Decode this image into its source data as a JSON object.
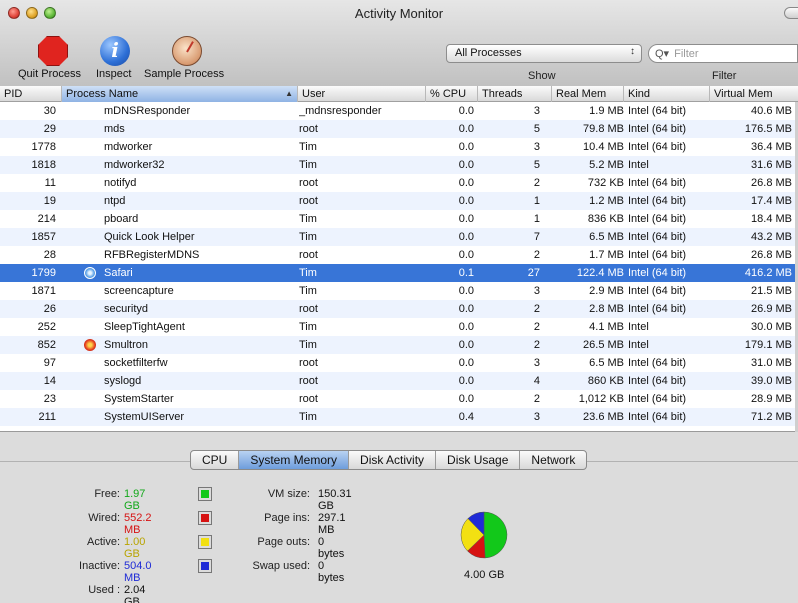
{
  "window": {
    "title": "Activity Monitor"
  },
  "toolbar": {
    "quit_label": "Quit Process",
    "inspect_label": "Inspect",
    "sample_label": "Sample Process",
    "show_selected": "All Processes",
    "show_label": "Show",
    "filter_placeholder": "Filter",
    "filter_label": "Filter"
  },
  "table": {
    "columns": [
      "PID",
      "Process Name",
      "User",
      "% CPU",
      "Threads",
      "Real Mem",
      "Kind",
      "Virtual Mem"
    ],
    "sorted_column": "Process Name",
    "rows": [
      {
        "pid": "30",
        "name": "mDNSResponder",
        "user": "_mdnsresponder",
        "cpu": "0.0",
        "threads": "3",
        "real": "1.9 MB",
        "kind": "Intel (64 bit)",
        "virtual": "40.6 MB"
      },
      {
        "pid": "29",
        "name": "mds",
        "user": "root",
        "cpu": "0.0",
        "threads": "5",
        "real": "79.8 MB",
        "kind": "Intel (64 bit)",
        "virtual": "176.5 MB"
      },
      {
        "pid": "1778",
        "name": "mdworker",
        "user": "Tim",
        "cpu": "0.0",
        "threads": "3",
        "real": "10.4 MB",
        "kind": "Intel (64 bit)",
        "virtual": "36.4 MB"
      },
      {
        "pid": "1818",
        "name": "mdworker32",
        "user": "Tim",
        "cpu": "0.0",
        "threads": "5",
        "real": "5.2 MB",
        "kind": "Intel",
        "virtual": "31.6 MB"
      },
      {
        "pid": "11",
        "name": "notifyd",
        "user": "root",
        "cpu": "0.0",
        "threads": "2",
        "real": "732 KB",
        "kind": "Intel (64 bit)",
        "virtual": "26.8 MB"
      },
      {
        "pid": "19",
        "name": "ntpd",
        "user": "root",
        "cpu": "0.0",
        "threads": "1",
        "real": "1.2 MB",
        "kind": "Intel (64 bit)",
        "virtual": "17.4 MB"
      },
      {
        "pid": "214",
        "name": "pboard",
        "user": "Tim",
        "cpu": "0.0",
        "threads": "1",
        "real": "836 KB",
        "kind": "Intel (64 bit)",
        "virtual": "18.4 MB"
      },
      {
        "pid": "1857",
        "name": "Quick Look Helper",
        "user": "Tim",
        "cpu": "0.0",
        "threads": "7",
        "real": "6.5 MB",
        "kind": "Intel (64 bit)",
        "virtual": "43.2 MB"
      },
      {
        "pid": "28",
        "name": "RFBRegisterMDNS",
        "user": "root",
        "cpu": "0.0",
        "threads": "2",
        "real": "1.7 MB",
        "kind": "Intel (64 bit)",
        "virtual": "26.8 MB"
      },
      {
        "pid": "1799",
        "name": "Safari",
        "user": "Tim",
        "cpu": "0.1",
        "threads": "27",
        "real": "122.4 MB",
        "kind": "Intel (64 bit)",
        "virtual": "416.2 MB",
        "icon": "safari-icon",
        "selected": true
      },
      {
        "pid": "1871",
        "name": "screencapture",
        "user": "Tim",
        "cpu": "0.0",
        "threads": "3",
        "real": "2.9 MB",
        "kind": "Intel (64 bit)",
        "virtual": "21.5 MB"
      },
      {
        "pid": "26",
        "name": "securityd",
        "user": "root",
        "cpu": "0.0",
        "threads": "2",
        "real": "2.8 MB",
        "kind": "Intel (64 bit)",
        "virtual": "26.9 MB"
      },
      {
        "pid": "252",
        "name": "SleepTightAgent",
        "user": "Tim",
        "cpu": "0.0",
        "threads": "2",
        "real": "4.1 MB",
        "kind": "Intel",
        "virtual": "30.0 MB"
      },
      {
        "pid": "852",
        "name": "Smultron",
        "user": "Tim",
        "cpu": "0.0",
        "threads": "2",
        "real": "26.5 MB",
        "kind": "Intel",
        "virtual": "179.1 MB",
        "icon": "smultron-icon"
      },
      {
        "pid": "97",
        "name": "socketfilterfw",
        "user": "root",
        "cpu": "0.0",
        "threads": "3",
        "real": "6.5 MB",
        "kind": "Intel (64 bit)",
        "virtual": "31.0 MB"
      },
      {
        "pid": "14",
        "name": "syslogd",
        "user": "root",
        "cpu": "0.0",
        "threads": "4",
        "real": "860 KB",
        "kind": "Intel (64 bit)",
        "virtual": "39.0 MB"
      },
      {
        "pid": "23",
        "name": "SystemStarter",
        "user": "root",
        "cpu": "0.0",
        "threads": "2",
        "real": "1,012 KB",
        "kind": "Intel (64 bit)",
        "virtual": "28.9 MB"
      },
      {
        "pid": "211",
        "name": "SystemUIServer",
        "user": "Tim",
        "cpu": "0.4",
        "threads": "3",
        "real": "23.6 MB",
        "kind": "Intel (64 bit)",
        "virtual": "71.2 MB"
      }
    ]
  },
  "tabs": [
    "CPU",
    "System Memory",
    "Disk Activity",
    "Disk Usage",
    "Network"
  ],
  "active_tab": "System Memory",
  "memory": {
    "free_label": "Free:",
    "free_value": "1.97 GB",
    "free_color": "#12c81a",
    "wired_label": "Wired:",
    "wired_value": "552.2 MB",
    "wired_color": "#d61212",
    "active_label": "Active:",
    "active_value": "1.00 GB",
    "active_color": "#b8a400",
    "inactive_label": "Inactive:",
    "inactive_value": "504.0 MB",
    "inactive_color": "#1f2bd6",
    "used_label": "Used :",
    "used_value": "2.04 GB",
    "vm_size_label": "VM size:",
    "vm_size_value": "150.31 GB",
    "page_ins_label": "Page ins:",
    "page_ins_value": "297.1 MB",
    "page_outs_label": "Page outs:",
    "page_outs_value": "0 bytes",
    "swap_used_label": "Swap used:",
    "swap_used_value": "0 bytes",
    "total": "4.00 GB"
  },
  "pie": {
    "slices": [
      {
        "name": "Free",
        "value": 1.97,
        "color": "#12c81a"
      },
      {
        "name": "Wired",
        "value": 0.539,
        "color": "#d61212"
      },
      {
        "name": "Active",
        "value": 1.0,
        "color": "#f2e012"
      },
      {
        "name": "Inactive",
        "value": 0.492,
        "color": "#1f2bd6"
      }
    ]
  }
}
